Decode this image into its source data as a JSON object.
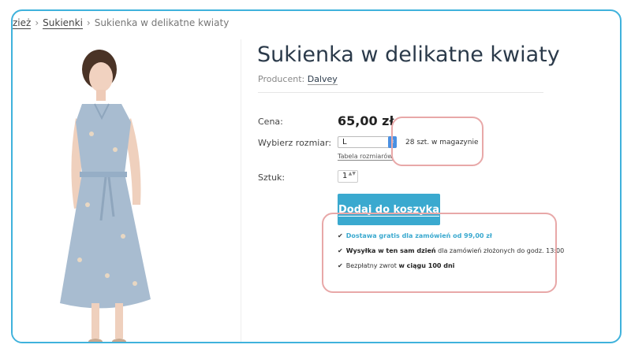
{
  "breadcrumb": {
    "item1": "zież",
    "item2": "Sukienki",
    "current": "Sukienka w delikatne kwiaty",
    "sep": "›"
  },
  "product": {
    "title": "Sukienka w delikatne kwiaty",
    "producer_label": "Producent:",
    "producer_name": "Dalvey",
    "price_label": "Cena:",
    "price": "65,00 zł",
    "size_label": "Wybierz rozmiar:",
    "size_value": "L",
    "stock": "28 szt. w magazynie",
    "size_table": "Tabela rozmiarów",
    "qty_label": "Sztuk:",
    "qty_value": "1",
    "cart_button": "Dodaj do koszyka"
  },
  "benefits": {
    "b1": "Dostawa gratis dla zamówień od 99,00 zł",
    "b2_bold": "Wysyłka w ten sam dzień",
    "b2_rest": " dla zamówień złożonych do godz. 13:00",
    "b3_start": "Bezpłatny zwrot ",
    "b3_bold": "w ciągu 100 dni"
  },
  "colors": {
    "accent": "#3aa9cf",
    "frame": "#3fb2dc",
    "highlight": "#e8a8a8",
    "dress": "#a8bcd0"
  },
  "icons": {
    "check": "✔",
    "spin": "▲▼",
    "select_arrow": "⇕"
  }
}
